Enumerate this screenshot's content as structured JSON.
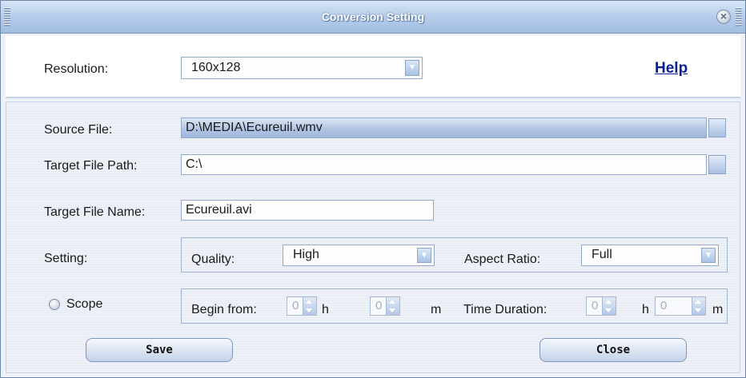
{
  "window": {
    "title": "Conversion Setting"
  },
  "resolution": {
    "label": "Resolution:",
    "value": "160x128"
  },
  "help_label": "Help",
  "source_file": {
    "label": "Source File:",
    "value": "D:\\MEDIA\\Ecureuil.wmv"
  },
  "target_path": {
    "label": "Target File Path:",
    "value": "C:\\"
  },
  "target_name": {
    "label": "Target File Name:",
    "value": "Ecureuil.avi"
  },
  "setting": {
    "label": "Setting:",
    "quality": {
      "label": "Quality:",
      "value": "High"
    },
    "aspect_ratio": {
      "label": "Aspect Ratio:",
      "value": "Full"
    }
  },
  "scope": {
    "label": "Scope",
    "begin_label": "Begin from:",
    "begin_hours": "0",
    "hours_unit": "h",
    "begin_minutes": "0",
    "minutes_unit": "m",
    "duration_label": "Time Duration:",
    "duration_hours": "0",
    "duration_minutes": "0"
  },
  "buttons": {
    "save": "Save",
    "close": "Close"
  },
  "icons": {
    "close": "close-icon",
    "dropdown": "chevron-down-icon",
    "browse": "browse-icon"
  }
}
